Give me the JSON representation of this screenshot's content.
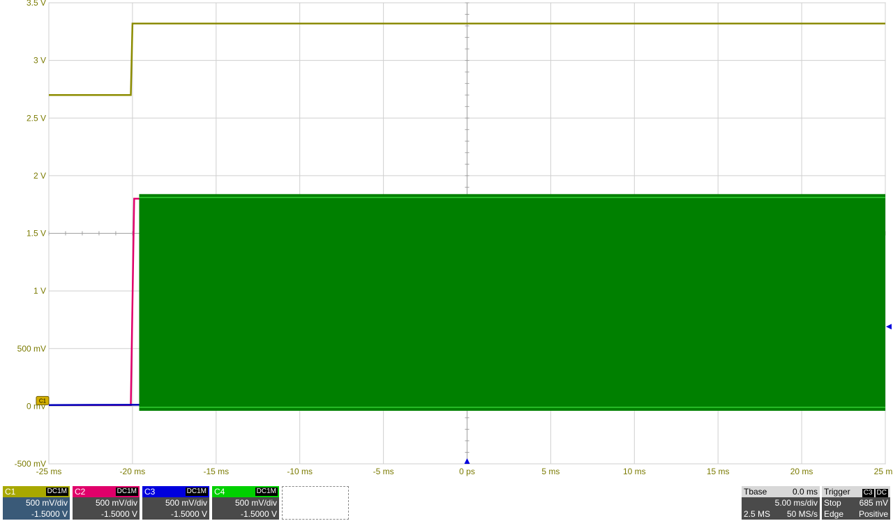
{
  "chart_data": {
    "type": "line",
    "xlabel": "",
    "ylabel": "",
    "xlim": [
      -25,
      25
    ],
    "ylim": [
      -0.5,
      3.5
    ],
    "x_tick_labels": [
      {
        "v": -25,
        "t": "-25 ms"
      },
      {
        "v": -20,
        "t": "-20 ms"
      },
      {
        "v": -15,
        "t": "-15 ms"
      },
      {
        "v": -10,
        "t": "-10 ms"
      },
      {
        "v": -5,
        "t": "-5 ms"
      },
      {
        "v": 0,
        "t": "0 ps"
      },
      {
        "v": 5,
        "t": "5 ms"
      },
      {
        "v": 10,
        "t": "10 ms"
      },
      {
        "v": 15,
        "t": "15 ms"
      },
      {
        "v": 20,
        "t": "20 ms"
      },
      {
        "v": 25,
        "t": "25 ms"
      }
    ],
    "y_tick_labels": [
      {
        "v": 3.5,
        "t": "3.5 V"
      },
      {
        "v": 3.0,
        "t": "3 V"
      },
      {
        "v": 2.5,
        "t": "2.5 V"
      },
      {
        "v": 2.0,
        "t": "2 V"
      },
      {
        "v": 1.5,
        "t": "1.5 V"
      },
      {
        "v": 1.0,
        "t": "1 V"
      },
      {
        "v": 0.5,
        "t": "500 mV"
      },
      {
        "v": 0.0,
        "t": "0 mV"
      },
      {
        "v": -0.5,
        "t": "-500 mV"
      }
    ],
    "grid": true,
    "series": [
      {
        "color": "#8c8c00",
        "x": [
          -25,
          -20.1,
          -20.0,
          25
        ],
        "y": [
          2.7,
          2.7,
          3.32,
          3.32
        ]
      },
      {
        "color": "#e0006a",
        "x": [
          -25,
          -20.1,
          -19.9,
          -19.6
        ],
        "y": [
          0.01,
          0.01,
          1.8,
          1.8
        ]
      },
      {
        "color": "#0000bb",
        "x": [
          -25,
          -0.1,
          0.0,
          0.3,
          25
        ],
        "y": [
          0.01,
          0.02,
          1.7,
          1.73,
          1.75
        ]
      },
      {
        "color": "#008000",
        "type": "band",
        "x": [
          -19.6,
          25
        ],
        "y_low": -0.04,
        "y_high": 1.84,
        "y_inner_low": -0.01,
        "y_inner_high": 1.81
      }
    ],
    "ground_marker": "C1",
    "trigger_marker_x": 0,
    "trigger_level_y": 0.69
  },
  "channels": [
    {
      "name": "C1",
      "coupling": "DC1M",
      "vdiv": "500 mV/div",
      "offset": "-1.5000 V",
      "color": "#a8a800"
    },
    {
      "name": "C2",
      "coupling": "DC1M",
      "vdiv": "500 mV/div",
      "offset": "-1.5000 V",
      "color": "#e0006a"
    },
    {
      "name": "C3",
      "coupling": "DC1M",
      "vdiv": "500 mV/div",
      "offset": "-1.5000 V",
      "color": "#0000dd"
    },
    {
      "name": "C4",
      "coupling": "DC1M",
      "vdiv": "500 mV/div",
      "offset": "-1.5000 V",
      "color": "#00d000"
    }
  ],
  "timebase": {
    "label": "Tbase",
    "delay": "0.0 ms",
    "tdiv": "5.00 ms/div",
    "samples": "2.5 MS",
    "rate": "50 MS/s"
  },
  "trigger": {
    "label": "Trigger",
    "source": "C3",
    "coupling": "DC",
    "mode": "Stop",
    "level": "685 mV",
    "type": "Edge",
    "slope": "Positive"
  }
}
